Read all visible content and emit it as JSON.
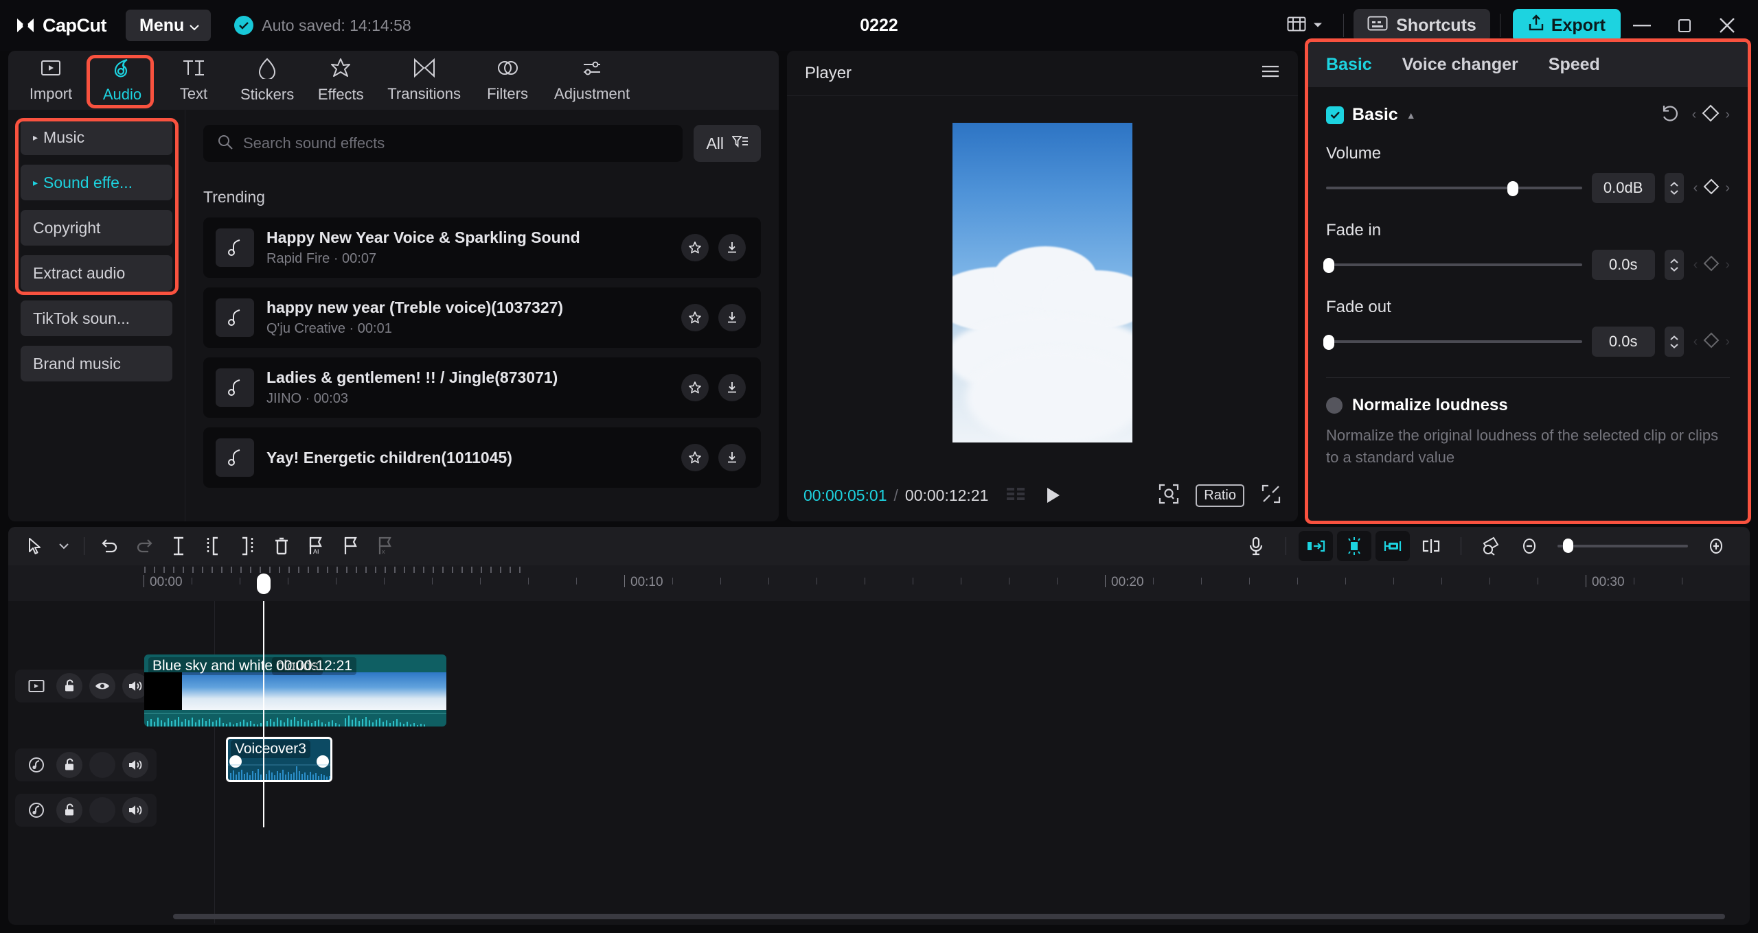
{
  "titlebar": {
    "brand": "CapCut",
    "menu_label": "Menu",
    "autosave_text": "Auto saved: 14:14:58",
    "project_title": "0222",
    "shortcuts_label": "Shortcuts",
    "export_label": "Export",
    "minimize_icon": "minimize-icon",
    "maximize_icon": "maximize-icon",
    "close_icon": "close-icon",
    "layout_icon": "layout-icon",
    "accent_color": "#1dd3e0",
    "highlight_color": "#f9523f"
  },
  "nav_tabs": [
    {
      "label": "Import",
      "icon": "import-icon",
      "active": false
    },
    {
      "label": "Audio",
      "icon": "audio-note-icon",
      "active": true
    },
    {
      "label": "Text",
      "icon": "text-icon",
      "active": false
    },
    {
      "label": "Stickers",
      "icon": "sticker-icon",
      "active": false
    },
    {
      "label": "Effects",
      "icon": "effects-star-icon",
      "active": false
    },
    {
      "label": "Transitions",
      "icon": "transitions-icon",
      "active": false
    },
    {
      "label": "Filters",
      "icon": "filters-icon",
      "active": false
    },
    {
      "label": "Adjustment",
      "icon": "adjustment-sliders-icon",
      "active": false
    }
  ],
  "categories": [
    {
      "label": "Music",
      "expandable": true,
      "selected": false
    },
    {
      "label": "Sound effe...",
      "expandable": true,
      "selected": true
    },
    {
      "label": "Copyright",
      "expandable": false,
      "selected": false
    },
    {
      "label": "Extract audio",
      "expandable": false,
      "selected": false
    },
    {
      "label": "TikTok soun...",
      "expandable": false,
      "selected": false
    },
    {
      "label": "Brand music",
      "expandable": false,
      "selected": false
    }
  ],
  "library": {
    "search_placeholder": "Search sound effects",
    "search_value": "",
    "filter_label": "All",
    "section_title": "Trending",
    "items": [
      {
        "title": "Happy New Year Voice & Sparkling Sound",
        "author": "Rapid Fire",
        "duration": "00:07"
      },
      {
        "title": "happy new year (Treble voice)(1037327)",
        "author": "Q'ju Creative",
        "duration": "00:01"
      },
      {
        "title": "Ladies & gentlemen! !! / Jingle(873071)",
        "author": "JIINO",
        "duration": "00:03"
      },
      {
        "title": "Yay! Energetic children(1011045)",
        "author": "",
        "duration": ""
      }
    ]
  },
  "player": {
    "title": "Player",
    "current_time": "00:00:05:01",
    "separator": "/",
    "total_time": "00:00:12:21",
    "ratio_label": "Ratio",
    "play_icon": "play-icon",
    "menu_icon": "hamburger-icon",
    "grid_icon": "grid-icon",
    "crop_icon": "crop-zoom-icon",
    "fullscreen_icon": "fullscreen-icon"
  },
  "properties": {
    "tabs": [
      {
        "label": "Basic",
        "active": true
      },
      {
        "label": "Voice changer",
        "active": false
      },
      {
        "label": "Speed",
        "active": false
      }
    ],
    "section_title": "Basic",
    "section_checked": true,
    "reset_icon": "reset-icon",
    "keyframe_icon": "keyframe-diamond-icon",
    "controls": [
      {
        "label": "Volume",
        "value": "0.0dB",
        "slider_pct": 73,
        "keyframe_enabled": true
      },
      {
        "label": "Fade in",
        "value": "0.0s",
        "slider_pct": 0,
        "keyframe_enabled": false
      },
      {
        "label": "Fade out",
        "value": "0.0s",
        "slider_pct": 0,
        "keyframe_enabled": false
      }
    ],
    "normalize": {
      "title": "Normalize loudness",
      "checked": false,
      "description": "Normalize the original loudness of the selected clip or clips to a standard value"
    }
  },
  "timeline": {
    "tools_left": [
      {
        "icon": "select-cursor-icon",
        "disabled": false
      },
      {
        "icon": "chevron-down-icon",
        "disabled": false
      },
      {
        "icon": "undo-icon",
        "disabled": false
      },
      {
        "icon": "redo-icon",
        "disabled": true
      },
      {
        "icon": "split-icon",
        "disabled": false
      },
      {
        "icon": "trim-left-icon",
        "disabled": false
      },
      {
        "icon": "trim-right-icon",
        "disabled": false
      },
      {
        "icon": "delete-icon",
        "disabled": false
      },
      {
        "icon": "ai-marker-icon",
        "disabled": false
      },
      {
        "icon": "flag-icon",
        "disabled": false
      },
      {
        "icon": "flag-remove-icon",
        "disabled": true
      }
    ],
    "tools_right": [
      {
        "icon": "microphone-icon",
        "active": false
      },
      {
        "icon": "snap-left-icon",
        "active": true
      },
      {
        "icon": "auto-highlight-icon",
        "active": true
      },
      {
        "icon": "snap-right-icon",
        "active": true
      },
      {
        "icon": "split-align-icon",
        "active": false
      },
      {
        "icon": "ruler-zoom-icon",
        "active": false
      },
      {
        "icon": "zoom-out-icon",
        "active": false
      },
      {
        "icon": "zoom-in-icon",
        "active": false
      }
    ],
    "ruler_labels": [
      "00:00",
      "00:10",
      "00:20",
      "00:30"
    ],
    "playhead_time": "00:00:05:01",
    "edit_icon": "pencil-edit-icon",
    "tracks": [
      {
        "type": "video",
        "head_icons": [
          "video-track-icon",
          "unlock-icon",
          "eye-icon",
          "speaker-icon"
        ],
        "clip": {
          "label": "Blue sky and white clouds",
          "duration": "00:00:12:21",
          "selected": false
        }
      },
      {
        "type": "audio",
        "head_icons": [
          "audio-track-icon",
          "unlock-icon",
          "empty-icon",
          "speaker-icon"
        ],
        "clip": {
          "label": "Voiceover3",
          "duration": "",
          "selected": true
        }
      },
      {
        "type": "audio",
        "head_icons": [
          "audio-track-icon",
          "unlock-icon",
          "empty-icon",
          "speaker-icon"
        ],
        "clip": null
      }
    ]
  }
}
